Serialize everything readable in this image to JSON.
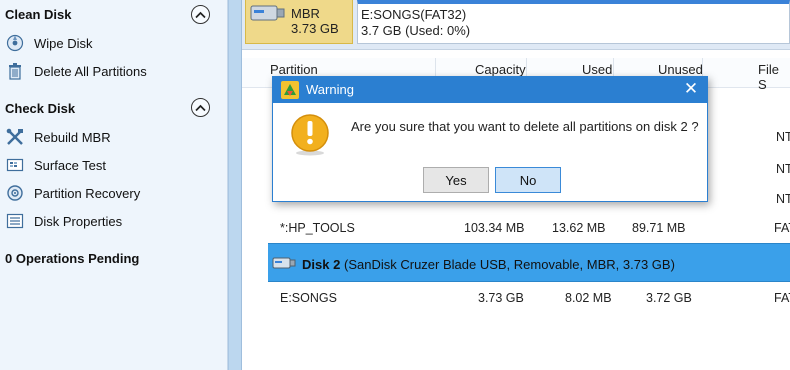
{
  "sidebar": {
    "clean_disk": {
      "title": "Clean Disk",
      "items": [
        {
          "label": "Wipe Disk",
          "icon": "wipe-disk-icon"
        },
        {
          "label": "Delete All Partitions",
          "icon": "trash-icon"
        }
      ]
    },
    "check_disk": {
      "title": "Check Disk",
      "items": [
        {
          "label": "Rebuild MBR",
          "icon": "tools-icon"
        },
        {
          "label": "Surface Test",
          "icon": "surface-test-icon"
        },
        {
          "label": "Partition Recovery",
          "icon": "recovery-icon"
        },
        {
          "label": "Disk Properties",
          "icon": "properties-icon"
        }
      ]
    },
    "pending": "0 Operations Pending"
  },
  "diskmap": {
    "disk_card": {
      "name": "Disk 2",
      "type": "MBR",
      "size": "3.73 GB"
    },
    "partition_card": {
      "label": "E:SONGS(FAT32)",
      "usage": "3.7 GB (Used: 0%)"
    }
  },
  "table": {
    "columns": [
      "Partition",
      "Capacity",
      "Used",
      "Unused",
      "File S"
    ],
    "rows_partial": [
      {
        "partition": "*:HP_TOOLS",
        "capacity": "103.34 MB",
        "used": "13.62 MB",
        "unused": "89.71 MB",
        "fs": "FAT"
      }
    ],
    "disk_row": {
      "name": "Disk 2",
      "desc": "(SanDisk Cruzer Blade USB, Removable, MBR, 3.73 GB)"
    },
    "disk2_rows": [
      {
        "partition": "E:SONGS",
        "capacity": "3.73 GB",
        "used": "8.02 MB",
        "unused": "3.72 GB",
        "fs": "FAT"
      }
    ],
    "hidden_fs_fragments": [
      "NT",
      "NT",
      "NT"
    ]
  },
  "dialog": {
    "title": "Warning",
    "message": "Are you sure that you want to delete all partitions on disk 2 ?",
    "yes": "Yes",
    "no": "No"
  },
  "colors": {
    "accent": "#2b7fd1",
    "selection": "#3aa0ea",
    "sidebar_bg": "#eef5fc",
    "disk_card": "#efd98a"
  }
}
